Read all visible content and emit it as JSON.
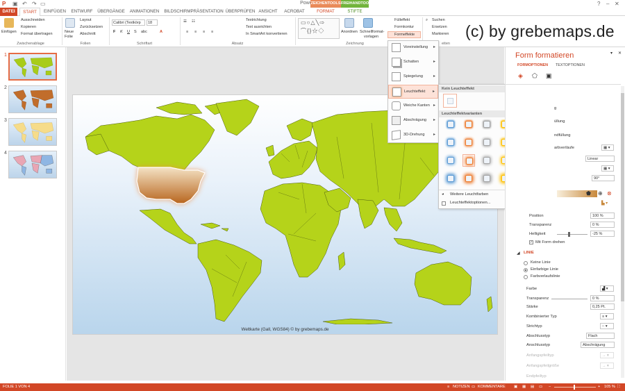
{
  "window": {
    "title": "PowerPoint"
  },
  "context_tabs": {
    "zeichentools": "ZEICHENTOOLS",
    "freihandtools": "FREIHANDTOOLS"
  },
  "tabs": {
    "datei": "DATEI",
    "start": "START",
    "einfuegen": "EINFÜGEN",
    "entwurf": "ENTWURF",
    "uebergaenge": "ÜBERGÄNGE",
    "animationen": "ANIMATIONEN",
    "bildschirm": "BILDSCHIRMPRÄSENTATION",
    "ueberpruefen": "ÜBERPRÜFEN",
    "ansicht": "ANSICHT",
    "acrobat": "ACROBAT",
    "format": "FORMAT",
    "stifte": "STIFTE"
  },
  "ribbon": {
    "clipboard": {
      "paste": "Einfügen",
      "cut": "Ausschneiden",
      "copy": "Kopieren",
      "format_painter": "Format übertragen",
      "group": "Zwischenablage"
    },
    "slides": {
      "new_slide": "Neue",
      "new_slide2": "Folie",
      "layout": "Layout",
      "reset": "Zurücksetzen",
      "section": "Abschnitt",
      "group": "Folien"
    },
    "font": {
      "font_name": "Calibri (Textkörp",
      "font_size": "18",
      "group": "Schriftart"
    },
    "paragraph": {
      "text_direction": "Textrichtung",
      "align_text": "Text ausrichten",
      "smartart": "In SmartArt konvertieren",
      "group": "Absatz"
    },
    "drawing": {
      "arrange": "Anordnen",
      "quick_styles": "Schnellformat-",
      "quick_styles2": "vorlagen",
      "fill": "Fülleffekt",
      "outline": "Formkontur",
      "effects": "Formeffekte",
      "group": "Zeichnung"
    },
    "editing": {
      "find": "Suchen",
      "replace": "Ersetzen",
      "select": "Markieren",
      "group": "eiten"
    }
  },
  "watermark": "(c) by grebemaps.de",
  "thumbnails": [
    "1",
    "2",
    "3",
    "4"
  ],
  "slide": {
    "caption": "Weltkarte (Gall, WGS84) © by grebemaps.de"
  },
  "effects_menu": {
    "items": [
      "Voreinstellung",
      "Schatten",
      "Spiegelung",
      "Leuchteffekt",
      "Weiche Kanten",
      "Abschrägung",
      "3D-Drehung"
    ]
  },
  "glow_gallery": {
    "no_glow": "Kein Leuchteffekt",
    "variants": "Leuchteffektvarianten",
    "more_colors": "Weitere Leuchtfarben",
    "options": "Leuchteffektoptionen...",
    "colors": [
      "#5b9bd5",
      "#ed7d31",
      "#a5a5a5",
      "#ffc000",
      "#4472c4",
      "#70ad47"
    ]
  },
  "format_pane": {
    "title": "Form formatieren",
    "tab_shape": "FORMOPTIONEN",
    "tab_text": "TEXTOPTIONEN",
    "fill_partial": [
      "g",
      "üllung",
      "ndfüllung",
      "arbverläufe"
    ],
    "gradient_type": "Linear",
    "angle": "90°",
    "position_label": "Position",
    "position_value": "100 %",
    "transparency_label": "Transparenz",
    "transparency_value": "0 %",
    "brightness_label": "Helligkeit",
    "brightness_value": "-25 %",
    "rotate_with_shape": "Mit Form drehen",
    "line_section": "LINIE",
    "no_line": "Keine Linie",
    "solid_line": "Einfarbige Linie",
    "gradient_line": "Farbverlaufslinie",
    "color_label": "Farbe",
    "line_transparency_label": "Transparenz",
    "line_transparency_value": "0 %",
    "width_label": "Stärke",
    "width_value": "0,25 Pt.",
    "compound_label": "Verbundtyp",
    "compound_label_shown": "Kombinierter Typ",
    "dash_label": "Strichtyp",
    "cap_label": "Abschlusstyp",
    "cap_value": "Flach",
    "join_label": "Anschlusstyp",
    "join_value": "Abschrägung",
    "begin_type": "Anfangspfeiltyp",
    "begin_size": "Anfangspfeilgröße",
    "end_type": "Endpfeiltyp"
  },
  "statusbar": {
    "slide_info": "FOLIE 1 VON 4",
    "notes": "NOTIZEN",
    "comments": "KOMMENTARE",
    "zoom": "105 %"
  },
  "colors": {
    "accent": "#d24726",
    "land": "#b5d31a",
    "usa": "#d8a458"
  }
}
